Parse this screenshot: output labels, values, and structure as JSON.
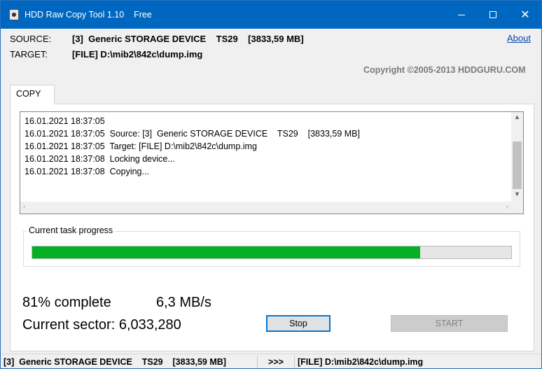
{
  "window": {
    "title": "HDD Raw Copy Tool 1.10    Free"
  },
  "header": {
    "source_label": "SOURCE:",
    "source_value": "[3]  Generic STORAGE DEVICE    TS29    [3833,59 MB]",
    "target_label": "TARGET:",
    "target_value": "[FILE] D:\\mib2\\842c\\dump.img",
    "about_link": "About",
    "copyright": "Copyright ©2005-2013 HDDGURU.COM"
  },
  "tabs": [
    {
      "label": "COPY",
      "active": true
    }
  ],
  "log": {
    "lines": [
      "16.01.2021 18:37:05",
      "16.01.2021 18:37:05  Source: [3]  Generic STORAGE DEVICE    TS29    [3833,59 MB]",
      "16.01.2021 18:37:05  Target: [FILE] D:\\mib2\\842c\\dump.img",
      "16.01.2021 18:37:08  Locking device...",
      "16.01.2021 18:37:08  Copying..."
    ]
  },
  "progress": {
    "group_label": "Current task progress",
    "fraction": 0.81,
    "color": "#06b025"
  },
  "stats": {
    "complete": "81% complete",
    "speed": "6,3 MB/s",
    "sector": "Current sector: 6,033,280"
  },
  "buttons": {
    "stop": "Stop",
    "start": "START"
  },
  "statusbar": {
    "source": "[3]  Generic STORAGE DEVICE    TS29    [3833,59 MB]",
    "arrows": ">>>",
    "target": "[FILE] D:\\mib2\\842c\\dump.img"
  },
  "icons": {
    "app": "hdd-icon",
    "minimize": "minimize-icon",
    "maximize": "maximize-icon",
    "close": "close-icon"
  },
  "colors": {
    "titlebar": "#0067c0",
    "progress_fill": "#06b025",
    "focus_border": "#0078d7",
    "link": "#0645ad"
  }
}
